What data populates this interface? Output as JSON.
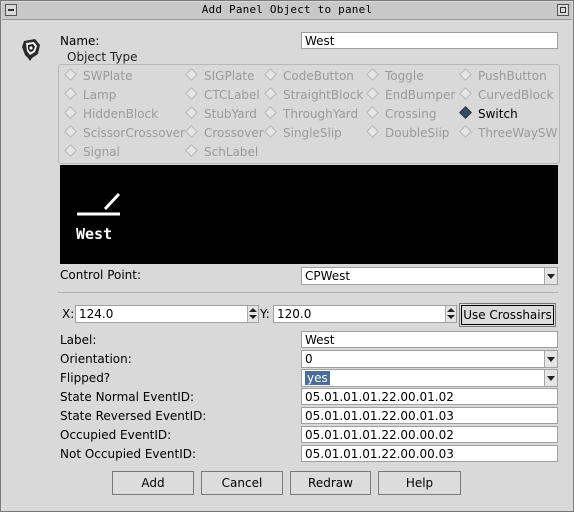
{
  "window": {
    "title": "Add Panel Object to panel"
  },
  "form": {
    "name_label": "Name:",
    "name_value": "West",
    "object_type_label": "Object Type",
    "object_types": [
      {
        "label": "SWPlate",
        "checked": false
      },
      {
        "label": "SIGPlate",
        "checked": false
      },
      {
        "label": "CodeButton",
        "checked": false
      },
      {
        "label": "Toggle",
        "checked": false
      },
      {
        "label": "PushButton",
        "checked": false
      },
      {
        "label": "Lamp",
        "checked": false
      },
      {
        "label": "CTCLabel",
        "checked": false
      },
      {
        "label": "StraightBlock",
        "checked": false
      },
      {
        "label": "EndBumper",
        "checked": false
      },
      {
        "label": "CurvedBlock",
        "checked": false
      },
      {
        "label": "HiddenBlock",
        "checked": false
      },
      {
        "label": "StubYard",
        "checked": false
      },
      {
        "label": "ThroughYard",
        "checked": false
      },
      {
        "label": "Crossing",
        "checked": false
      },
      {
        "label": "Switch",
        "checked": true
      },
      {
        "label": "ScissorCrossover",
        "checked": false
      },
      {
        "label": "Crossover",
        "checked": false
      },
      {
        "label": "SingleSlip",
        "checked": false
      },
      {
        "label": "DoubleSlip",
        "checked": false
      },
      {
        "label": "ThreeWaySW",
        "checked": false
      },
      {
        "label": "Signal",
        "checked": false
      },
      {
        "label": "SchLabel",
        "checked": false
      }
    ],
    "preview_text": "West",
    "control_point_label": "Control Point:",
    "control_point_value": "CPWest",
    "x_label": "X:",
    "x_value": "124.0",
    "y_label": "Y:",
    "y_value": "120.0",
    "crosshairs_label": "Use Crosshairs",
    "label_label": "Label:",
    "label_value": "West",
    "orientation_label": "Orientation:",
    "orientation_value": "0",
    "flipped_label": "Flipped?",
    "flipped_value": "yes",
    "state_normal_label": "State Normal EventID:",
    "state_normal_value": "05.01.01.01.22.00.01.02",
    "state_reversed_label": "State Reversed EventID:",
    "state_reversed_value": "05.01.01.01.22.00.01.03",
    "occupied_label": "Occupied EventID:",
    "occupied_value": "05.01.01.01.22.00.00.02",
    "not_occupied_label": "Not Occupied EventID:",
    "not_occupied_value": "05.01.01.01.22.00.00.03"
  },
  "buttons": {
    "add": "Add",
    "cancel": "Cancel",
    "redraw": "Redraw",
    "help": "Help"
  }
}
